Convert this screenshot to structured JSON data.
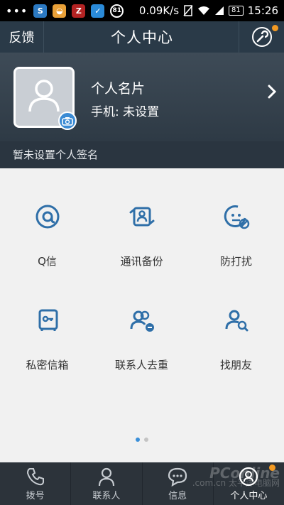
{
  "status_bar": {
    "dots": "•••",
    "apps": [
      {
        "icon": "s-app-icon",
        "glyph": "S",
        "bg": "#2b79c2"
      },
      {
        "icon": "cake-app-icon",
        "glyph": "◒",
        "bg": "#e8a038"
      },
      {
        "icon": "z-app-icon",
        "glyph": "Z",
        "bg": "#b32323"
      },
      {
        "icon": "shield-app-icon",
        "glyph": "✓",
        "bg": "#2a8ad8"
      },
      {
        "icon": "battery-badge-icon",
        "glyph": "81",
        "bg": "#2e7d32"
      }
    ],
    "speed": "0.09K/s",
    "battery": "81",
    "time": "15:26"
  },
  "header": {
    "feedback": "反馈",
    "title": "个人中心"
  },
  "profile": {
    "card_title": "个人名片",
    "phone": "手机: 未设置",
    "signature": "暂未设置个人签名"
  },
  "grid": {
    "items": [
      {
        "label": "Q信",
        "icon": "at-icon"
      },
      {
        "label": "通讯备份",
        "icon": "contacts-sync-icon"
      },
      {
        "label": "防打扰",
        "icon": "block-face-icon"
      },
      {
        "label": "私密信箱",
        "icon": "private-safe-icon"
      },
      {
        "label": "联系人去重",
        "icon": "contacts-dedupe-icon"
      },
      {
        "label": "找朋友",
        "icon": "find-friend-icon"
      }
    ],
    "pages": 2,
    "current_page": 1
  },
  "nav": {
    "tabs": [
      {
        "label": "拨号",
        "icon": "phone-icon"
      },
      {
        "label": "联系人",
        "icon": "contact-icon"
      },
      {
        "label": "信息",
        "icon": "message-icon"
      },
      {
        "label": "个人中心",
        "icon": "user-center-icon"
      }
    ],
    "active": 3
  },
  "watermark": {
    "brand": "PConline",
    "domain": ".com.cn",
    "cn": "太平洋电脑网"
  },
  "colors": {
    "accent": "#2f6fa8",
    "badge": "#f39a23",
    "header_bg": "#2a3a48"
  }
}
